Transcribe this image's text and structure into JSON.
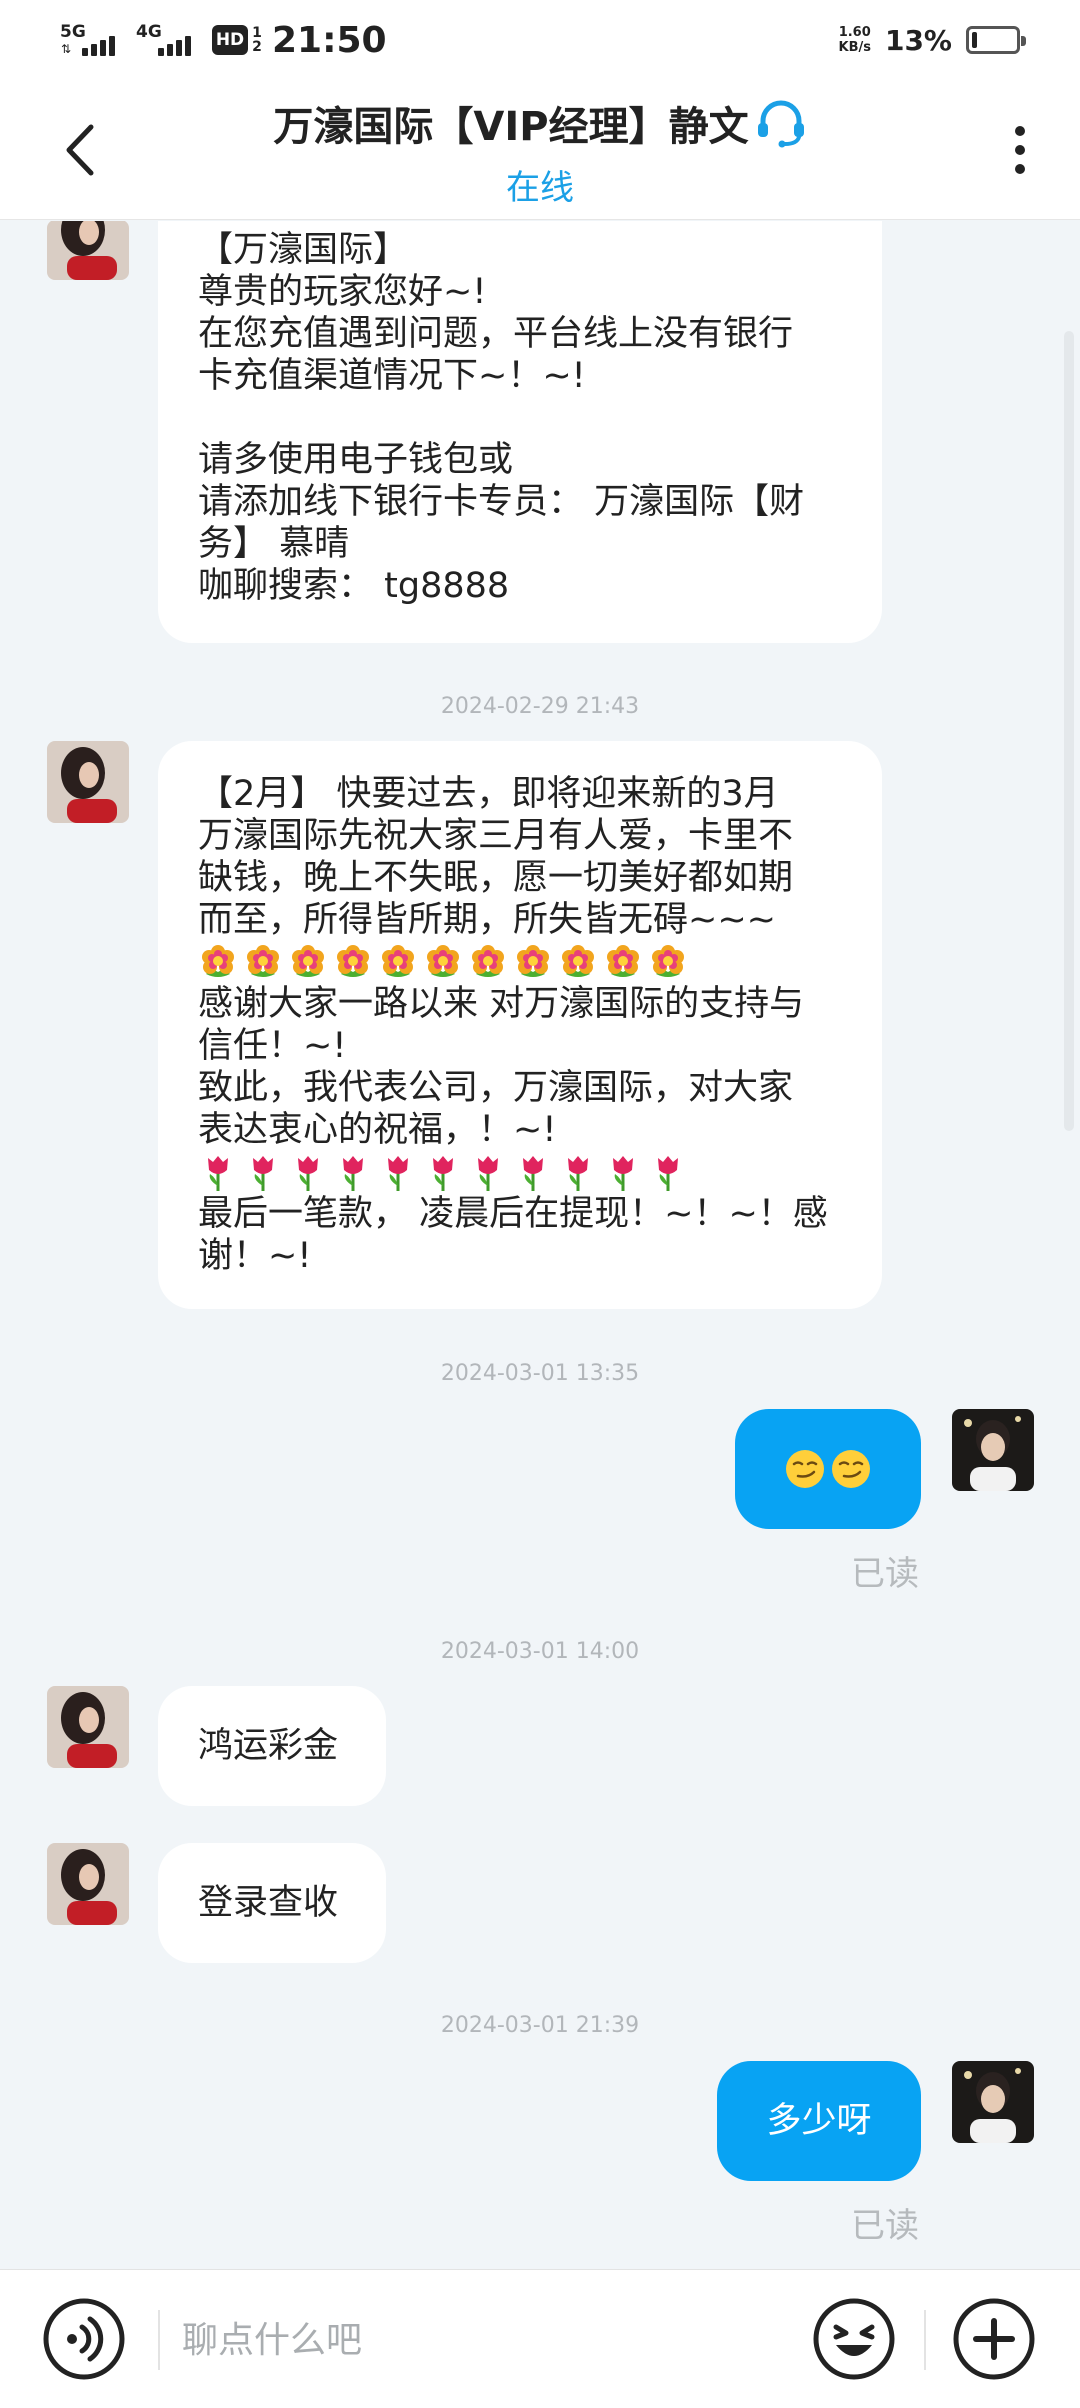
{
  "status_bar": {
    "network_1": "5G",
    "network_2": "4G",
    "hd_label": "HD",
    "hd_sub": "1 2",
    "time": "21:50",
    "speed_value": "1.60",
    "speed_unit": "KB/s",
    "battery_percent": "13%",
    "battery_level": 0.13
  },
  "header": {
    "title": "万濠国际【VIP经理】静文",
    "status": "在线",
    "icons": {
      "back": "back-arrow-icon",
      "headset": "headset-icon",
      "more": "more-vertical-icon"
    }
  },
  "messages": [
    {
      "direction": "incoming",
      "lines": [
        "【万濠国际】",
        "尊贵的玩家您好~!",
        "在您充值遇到问题，平台线上没有银行",
        "卡充值渠道情况下~！~!",
        "",
        "请多使用电子钱包或",
        "请添加线下银行卡专员： 万濠国际【财",
        "务】 慕晴",
        "咖聊搜索： tg8888"
      ]
    },
    {
      "timestamp": "2024-02-29 21:43"
    },
    {
      "direction": "incoming",
      "lines": [
        "【2月】 快要过去，即将迎来新的3月",
        "万濠国际先祝大家三月有人爱，卡里不",
        "缺钱，晚上不失眠，愿一切美好都如期",
        "而至，所得皆所期，所失皆无碍~~~",
        "[flower x11]",
        "感谢大家一路以来 对万濠国际的支持与",
        "信任！~!",
        "致此，我代表公司，万濠国际，对大家",
        "表达衷心的祝福，！~!",
        "[tulip x11]",
        "最后一笔款， 凌晨后在提现！~！~！感",
        "谢！~!"
      ]
    },
    {
      "timestamp": "2024-03-01 13:35"
    },
    {
      "direction": "outgoing",
      "content": "smirk-emoji x2",
      "read_status": "已读"
    },
    {
      "timestamp": "2024-03-01 14:00"
    },
    {
      "direction": "incoming",
      "text": "鸿运彩金"
    },
    {
      "direction": "incoming",
      "text": "登录查收"
    },
    {
      "timestamp": "2024-03-01 21:39"
    },
    {
      "direction": "outgoing",
      "text": "多少呀",
      "read_status": "已读"
    }
  ],
  "msg1": {
    "l1": "【万濠国际】",
    "l2": "尊贵的玩家您好~!",
    "l3": "在您充值遇到问题，平台线上没有银行",
    "l4": "卡充值渠道情况下~！~!",
    "l5": "请多使用电子钱包或",
    "l6": "请添加线下银行卡专员： 万濠国际【财",
    "l7": "务】 慕晴",
    "l8": "咖聊搜索： tg8888"
  },
  "ts1": "2024-02-29 21:43",
  "msg2": {
    "l1": "【2月】 快要过去，即将迎来新的3月",
    "l2": "万濠国际先祝大家三月有人爱，卡里不",
    "l3": "缺钱，晚上不失眠，愿一切美好都如期",
    "l4": "而至，所得皆所期，所失皆无碍~~~",
    "l5": "感谢大家一路以来 对万濠国际的支持与",
    "l6": "信任！~!",
    "l7": "致此，我代表公司，万濠国际，对大家",
    "l8": "表达衷心的祝福，！~!",
    "l9": "最后一笔款， 凌晨后在提现！~！~！感",
    "l10": "谢！~!",
    "flower_count": 11,
    "tulip_count": 11
  },
  "ts2": "2024-03-01 13:35",
  "msg3": {
    "emoji": "smirk-emoji",
    "emoji_count": 2,
    "read": "已读"
  },
  "ts3": "2024-03-01 14:00",
  "msg4": {
    "text": "鸿运彩金"
  },
  "msg5": {
    "text": "登录查收"
  },
  "ts4": "2024-03-01 21:39",
  "msg6": {
    "text": "多少呀",
    "read": "已读"
  },
  "input_bar": {
    "placeholder": "聊点什么吧",
    "icons": {
      "voice": "voice-icon",
      "emoji": "emoji-icon",
      "plus": "plus-icon"
    }
  },
  "colors": {
    "accent": "#1ba0e6",
    "outgoing_bubble": "#08a3f3",
    "background": "#f1f5f8",
    "timestamp": "#b2b6ba"
  }
}
